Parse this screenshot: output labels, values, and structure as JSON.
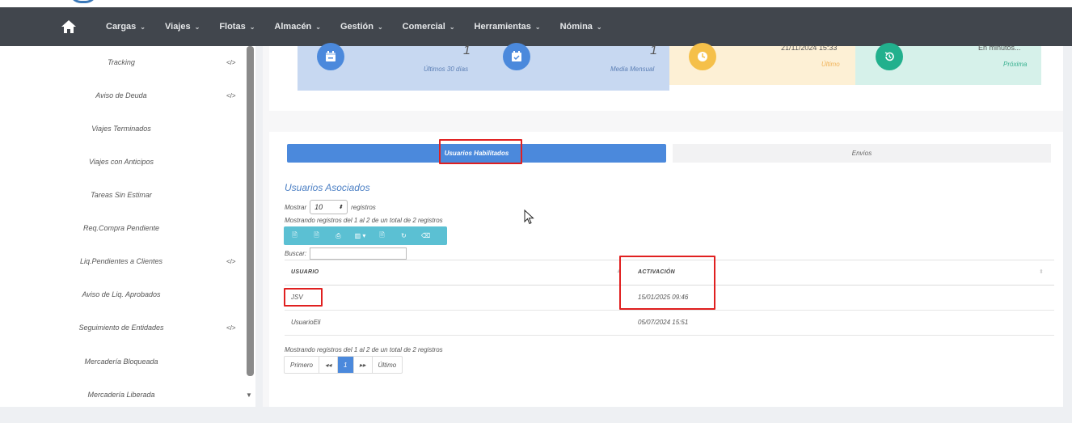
{
  "nav": {
    "items": [
      {
        "label": "Cargas",
        "chev": "⌄"
      },
      {
        "label": "Viajes",
        "chev": "⌄"
      },
      {
        "label": "Flotas",
        "chev": "⌄"
      },
      {
        "label": "Almacén",
        "chev": "⌄"
      },
      {
        "label": "Gestión",
        "chev": "⌄"
      },
      {
        "label": "Comercial",
        "chev": "⌄"
      },
      {
        "label": "Herramientas",
        "chev": "⌄"
      },
      {
        "label": "Nómina",
        "chev": "⌄"
      }
    ]
  },
  "sidebar": {
    "items": [
      {
        "label": "Tracking",
        "code": "</>"
      },
      {
        "label": "Aviso de Deuda",
        "code": "</>"
      },
      {
        "label": "Viajes Terminados",
        "code": ""
      },
      {
        "label": "Viajes con Anticipos",
        "code": ""
      },
      {
        "label": "Tareas Sin Estimar",
        "code": ""
      },
      {
        "label": "Req.Compra Pendiente",
        "code": ""
      },
      {
        "label": "Liq.Pendientes a Clientes",
        "code": "</>"
      },
      {
        "label": "Aviso de Liq. Aprobados",
        "code": ""
      },
      {
        "label": "Seguimiento de Entidades",
        "code": "</>"
      },
      {
        "label": "Mercadería Bloqueada",
        "code": ""
      },
      {
        "label": "Mercadería Liberada",
        "code": ""
      }
    ]
  },
  "stats": {
    "s1": {
      "num": "1",
      "label": "Últimos 30 días"
    },
    "s2": {
      "num": "1",
      "label": "Media Mensual"
    },
    "s3": {
      "num": "21/11/2024 15:33",
      "label": "Último"
    },
    "s4": {
      "num": "En minutos...",
      "label": "Próxima"
    }
  },
  "tabs": {
    "active": "Usuarios Habilitados",
    "inactive": "Envíos"
  },
  "section": {
    "title": "Usuarios Asociados",
    "show_prefix": "Mostrar",
    "show_value": "10",
    "show_suffix": "registros",
    "info_top": "Mostrando registros del 1 al 2 de un total de 2 registros",
    "search_label": "Buscar:"
  },
  "table": {
    "headers": {
      "user": "USUARIO",
      "activation": "ACTIVACIÓN"
    },
    "rows": [
      {
        "user": "JSV",
        "activation": "15/01/2025 09:46"
      },
      {
        "user": "UsuarioEli",
        "activation": "05/07/2024 15:51"
      }
    ]
  },
  "footer_info": "Mostrando registros del 1 al 2 de un total de 2 registros",
  "pager": {
    "first": "Primero",
    "prev": "◂◂",
    "page": "1",
    "next": "▸▸",
    "last": "Último"
  },
  "colors": {
    "accent": "#4b89dc",
    "nav_bg": "#41464d",
    "highlight": "#e02020"
  }
}
